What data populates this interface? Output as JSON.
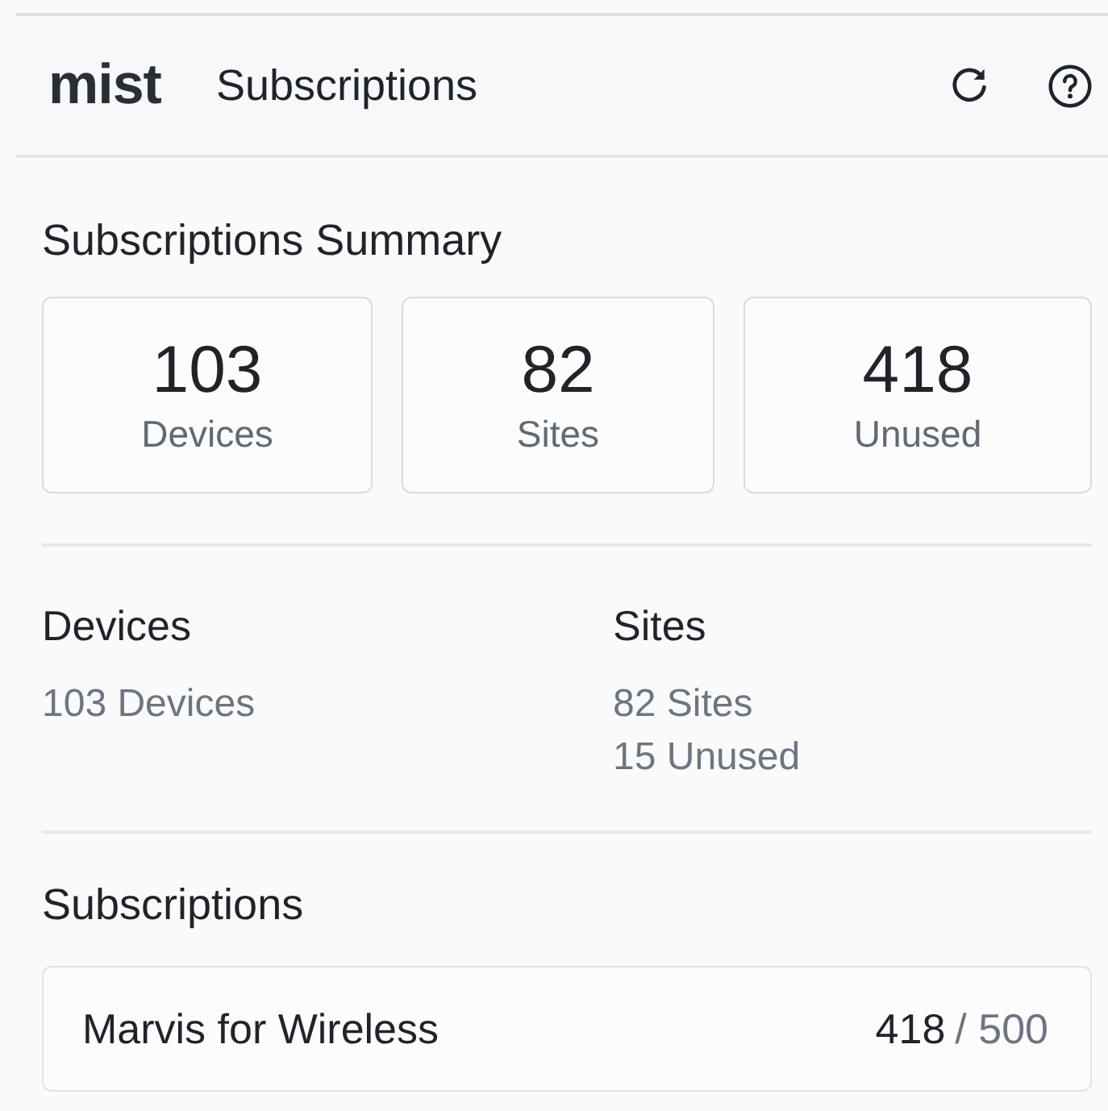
{
  "header": {
    "logo": "mist",
    "title": "Subscriptions"
  },
  "summary": {
    "title": "Subscriptions Summary",
    "cards": [
      {
        "value": "103",
        "label": "Devices"
      },
      {
        "value": "82",
        "label": "Sites"
      },
      {
        "value": "418",
        "label": "Unused"
      }
    ]
  },
  "details": [
    {
      "title": "Devices",
      "lines": [
        "103 Devices"
      ]
    },
    {
      "title": "Sites",
      "lines": [
        "82 Sites",
        "15 Unused"
      ]
    }
  ],
  "subscriptions": {
    "title": "Subscriptions",
    "items": [
      {
        "name": "Marvis for Wireless",
        "used": "418",
        "total": "/ 500"
      }
    ]
  }
}
